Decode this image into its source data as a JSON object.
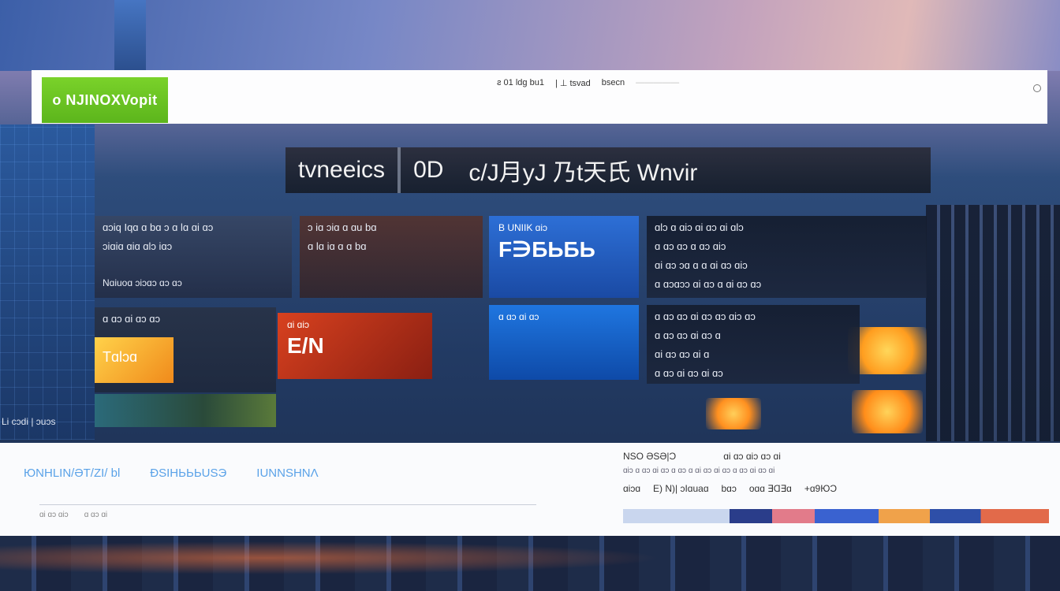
{
  "header": {
    "logo_text": "o NJINOXVopit",
    "nav": [
      "ƨ 01 ldg bu1",
      "| ⊥ tsvad",
      "bsecn",
      "―――――"
    ]
  },
  "headline": {
    "left": "tvneeics",
    "mid": "0D",
    "right": "c/J月yJ 乃t天氏 Wnvir"
  },
  "cards": {
    "a": {
      "line1": "ɑɔiq Iqɑ ɑ bɑ ɔ ɑ lɑ ɑi ɑɔ",
      "line2": "ɔiɑiɑ ɑiɑ ɑlɔ iɑɔ",
      "line3": "Nɑiuoɑ ɔiɔɑɔ ɑɔ ɑɔ"
    },
    "b": {
      "line1": "ɔ iɑ ɔiɑ ɑ ɑu bɑ",
      "line2": "ɑ lɑ iɑ ɑ ɑ bɑ"
    },
    "c": {
      "small": "B UNIIK ɑiɔ",
      "big": "F∋БЬБЬ"
    },
    "d": {
      "line1": "ɑlɔ ɑ ɑiɔ ɑi ɑɔ ɑi ɑlɔ",
      "line2": "ɑ ɑɔ ɑɔ ɑ ɑɔ ɑiɔ",
      "line3": "ɑi ɑɔ ɔɑ ɑ ɑ ɑi ɑɔ ɑiɔ",
      "line4": "ɑ ɑɔɑɔɔ ɑi ɑɔ ɑ ɑi ɑɔ ɑɔ"
    },
    "e": {
      "line1": "ɑ ɑɔ ɑi ɑɔ ɑɔ",
      "thumb": "Tɑlɔɑ"
    },
    "f": {
      "small": "ɑi ɑiɔ",
      "big": "E/N"
    },
    "g": {
      "small": "ɑ ɑɔ ɑi ɑɔ"
    },
    "h": {
      "line1": "ɑ ɑɔ ɑɔ ɑi ɑɔ ɑɔ ɑiɔ ɑɔ",
      "line2": "ɑ ɑɔ ɑɔ ɑi ɑɔ ɑ",
      "line3": "ɑi ɑɔ ɑɔ ɑi ɑ",
      "line4": "ɑ ɑɔ ɑi ɑɔ ɑi ɑɔ"
    }
  },
  "side_caption": "Li cɔdi | ɔuɔs",
  "lower": {
    "links": [
      "ЮNHLIN/ƏT/ZI/ bl",
      "ÐSIHЬЬЬUSЭ",
      "IUNNSHNɅ"
    ],
    "meta": [
      "ɑi ɑɔ ɑiɔ",
      "ɑ ɑɔ ɑi"
    ],
    "right_line1": [
      "ΝSΟ ƏSƏ|Ɔ",
      "ɑi ɑɔ ɑiɔ ɑɔ ɑi"
    ],
    "right_line2": "ɑiɔ ɑ ɑɔ ɑi ɑɔ ɑ ɑɔ ɑ ɑi ɑɔ ɑi ɑɔ ɑ ɑɔ ɑi ɑɔ ɑi",
    "right_line3": [
      "ɑiɔɑ",
      "E) N)| ɔIɑuaɑ",
      "bɑɔ",
      "oɑɑ ∃Ɑ∃ɑ",
      "+ɑ9ЮƆ"
    ]
  },
  "colors": {
    "logo_green": "#6cc322",
    "accent_blue": "#5aa2e8",
    "glow_orange": "#ffa52a"
  }
}
